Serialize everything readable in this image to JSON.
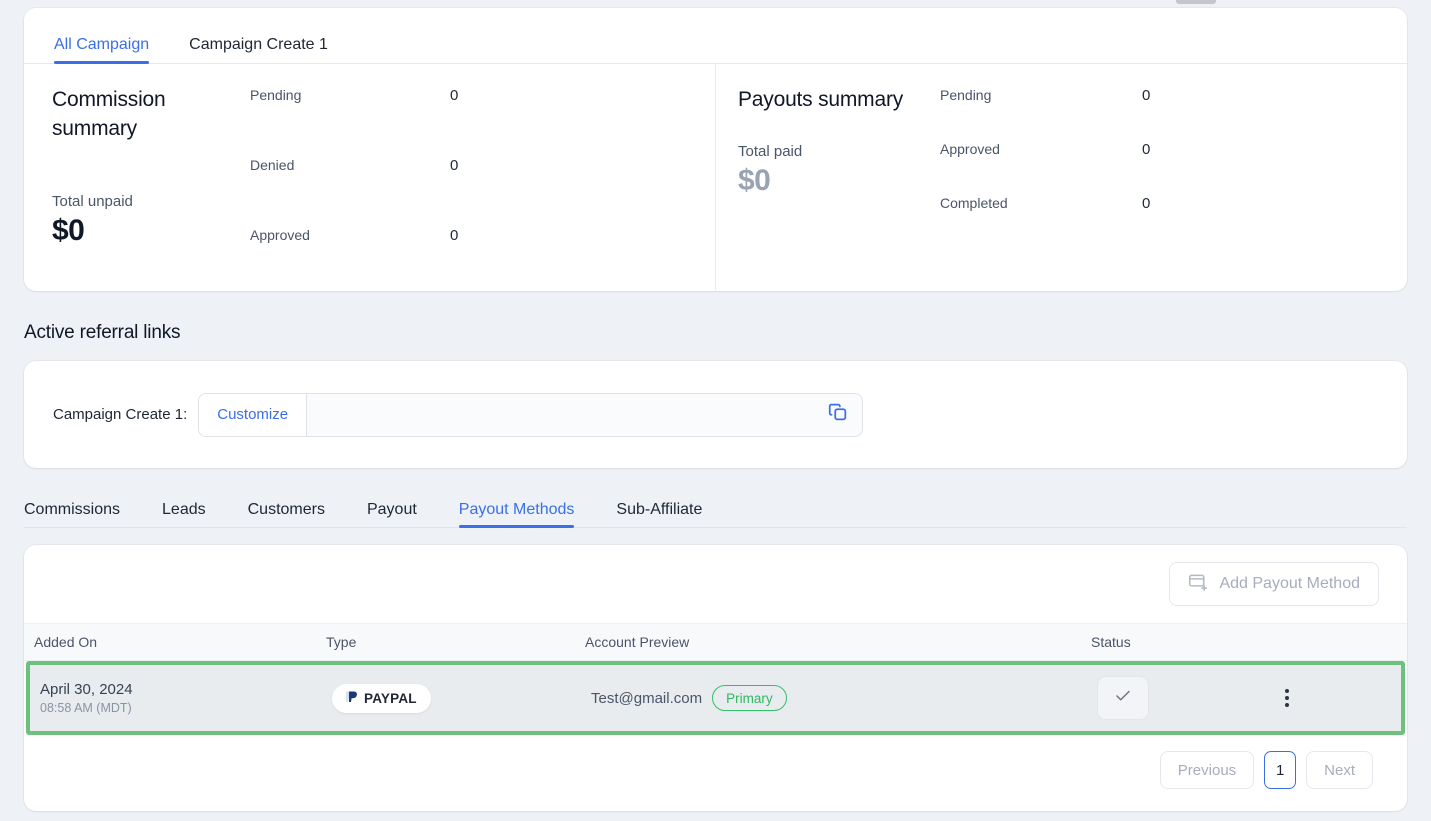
{
  "campaign_tabs": [
    {
      "label": "All Campaign",
      "active": true
    },
    {
      "label": "Campaign Create 1",
      "active": false
    }
  ],
  "commission_summary": {
    "title": "Commission summary",
    "total_label": "Total unpaid",
    "total_value": "$0",
    "stats": [
      {
        "label": "Pending",
        "value": "0"
      },
      {
        "label": "Denied",
        "value": "0"
      },
      {
        "label": "Approved",
        "value": "0"
      }
    ]
  },
  "payouts_summary": {
    "title": "Payouts summary",
    "total_label": "Total paid",
    "total_value": "$0",
    "stats": [
      {
        "label": "Pending",
        "value": "0"
      },
      {
        "label": "Approved",
        "value": "0"
      },
      {
        "label": "Completed",
        "value": "0"
      }
    ]
  },
  "referral": {
    "section_title": "Active referral links",
    "campaign_label": "Campaign Create 1:",
    "customize_label": "Customize",
    "link_value": "",
    "link_placeholder": "",
    "copy_icon": "copy-icon"
  },
  "subnav": [
    {
      "label": "Commissions",
      "active": false
    },
    {
      "label": "Leads",
      "active": false
    },
    {
      "label": "Customers",
      "active": false
    },
    {
      "label": "Payout",
      "active": false
    },
    {
      "label": "Payout Methods",
      "active": true
    },
    {
      "label": "Sub-Affiliate",
      "active": false
    }
  ],
  "payout_methods": {
    "add_button_label": "Add Payout Method",
    "add_button_icon": "card-plus-icon",
    "columns": {
      "added_on": "Added On",
      "type": "Type",
      "account_preview": "Account Preview",
      "status": "Status"
    },
    "rows": [
      {
        "date": "April 30, 2024",
        "time": "08:58 AM (MDT)",
        "type": "PAYPAL",
        "account": "Test@gmail.com",
        "badge": "Primary",
        "status_icon": "check-icon",
        "menu_icon": "kebab-menu-icon"
      }
    ]
  },
  "pagination": {
    "previous": "Previous",
    "page": "1",
    "next": "Next"
  },
  "colors": {
    "accent_blue": "#3b6fe8",
    "highlight_green": "#6ec17d",
    "badge_green": "#2fb863",
    "page_bg": "#eef1f5",
    "row_bg": "#e9ecef"
  }
}
